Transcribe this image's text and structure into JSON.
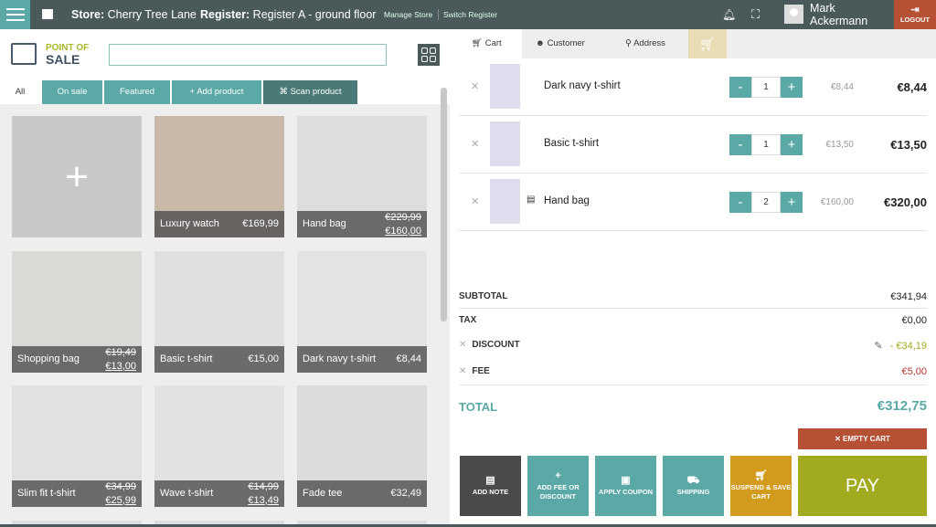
{
  "header": {
    "store_label": "Store:",
    "store": "Cherry Tree Lane",
    "register_label": "Register:",
    "register": "Register A - ground floor",
    "manage_store": "Manage Store",
    "switch_register": "Switch Register",
    "user_first": "Mark",
    "user_last": "Ackermann",
    "logout": "LOGOUT"
  },
  "logo": {
    "line1": "POINT OF",
    "line2": "SALE"
  },
  "search": {
    "value": "",
    "placeholder": ""
  },
  "filters": [
    "All",
    "On sale",
    "Featured",
    "+ Add product",
    "⌘ Scan product"
  ],
  "products": [
    {
      "name": "Luxury watch",
      "price": "€169,99",
      "old": "",
      "bg": "#c9b9a8"
    },
    {
      "name": "Hand bag",
      "price": "€160,00",
      "old": "€229,99",
      "bg": "#dcdedb"
    },
    {
      "name": "Shopping bag",
      "price": "€13,00",
      "old": "€19,49",
      "bg": "#d9dad6"
    },
    {
      "name": "Basic t-shirt",
      "price": "€15,00",
      "old": "",
      "bg": "#e0e0e0"
    },
    {
      "name": "Dark navy t-shirt",
      "price": "€8,44",
      "old": "",
      "bg": "#e3e3e3"
    },
    {
      "name": "Slim fit t-shirt",
      "price": "€25,99",
      "old": "€34,99",
      "bg": "#e1e1e1"
    },
    {
      "name": "Wave t-shirt",
      "price": "€13,49",
      "old": "€14,99",
      "bg": "#e2e2e2"
    },
    {
      "name": "Fade tee",
      "price": "€32,49",
      "old": "",
      "bg": "#dcdcdc"
    }
  ],
  "tabs": {
    "cart": "Cart",
    "customer": "Customer",
    "address": "Address"
  },
  "cart": [
    {
      "name": "Dark navy t-shirt",
      "qty": "1",
      "unit": "€8,44",
      "total": "€8,44"
    },
    {
      "name": "Basic t-shirt",
      "qty": "1",
      "unit": "€13,50",
      "total": "€13,50"
    },
    {
      "name": "Hand bag",
      "qty": "2",
      "unit": "€160,00",
      "total": "€320,00"
    }
  ],
  "summary": {
    "subtotal_label": "SUBTOTAL",
    "subtotal": "€341,94",
    "tax_label": "TAX",
    "tax": "€0,00",
    "discount_label": "DISCOUNT",
    "discount": "- €34,19",
    "fee_label": "FEE",
    "fee": "€5,00",
    "total_label": "TOTAL",
    "total": "€312,75"
  },
  "actions": {
    "empty_cart": "✕ EMPTY CART",
    "add_note": "ADD NOTE",
    "add_fee": "ADD FEE OR DISCOUNT",
    "coupon": "APPLY COUPON",
    "shipping": "SHIPPING",
    "suspend": "SUSPEND & SAVE CART",
    "pay": "PAY"
  },
  "colors": {
    "teal": "#5aa9a6",
    "header": "#4a5a5a",
    "danger": "#b65135",
    "pay": "#a2aa1f",
    "suspend": "#d39b1d",
    "discount": "#a2aa1f",
    "fee": "#b63535"
  }
}
